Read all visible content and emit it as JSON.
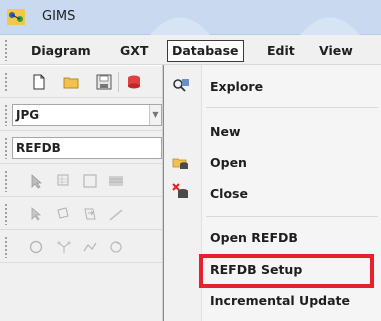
{
  "window": {
    "title": "GIMS"
  },
  "menubar": {
    "items": [
      {
        "label": "Diagram"
      },
      {
        "label": "GXT"
      },
      {
        "label": "Database"
      },
      {
        "label": "Edit"
      },
      {
        "label": "View"
      }
    ]
  },
  "toolbar": {
    "format_select": {
      "value": "JPG"
    },
    "database_select": {
      "value": "REFDB"
    }
  },
  "database_menu": {
    "items": [
      {
        "label": "Explore"
      },
      {
        "label": "New"
      },
      {
        "label": "Open"
      },
      {
        "label": "Close"
      },
      {
        "label": "Open REFDB"
      },
      {
        "label": "REFDB Setup"
      },
      {
        "label": "Incremental Update"
      }
    ],
    "highlight_color": "#e8202a"
  }
}
